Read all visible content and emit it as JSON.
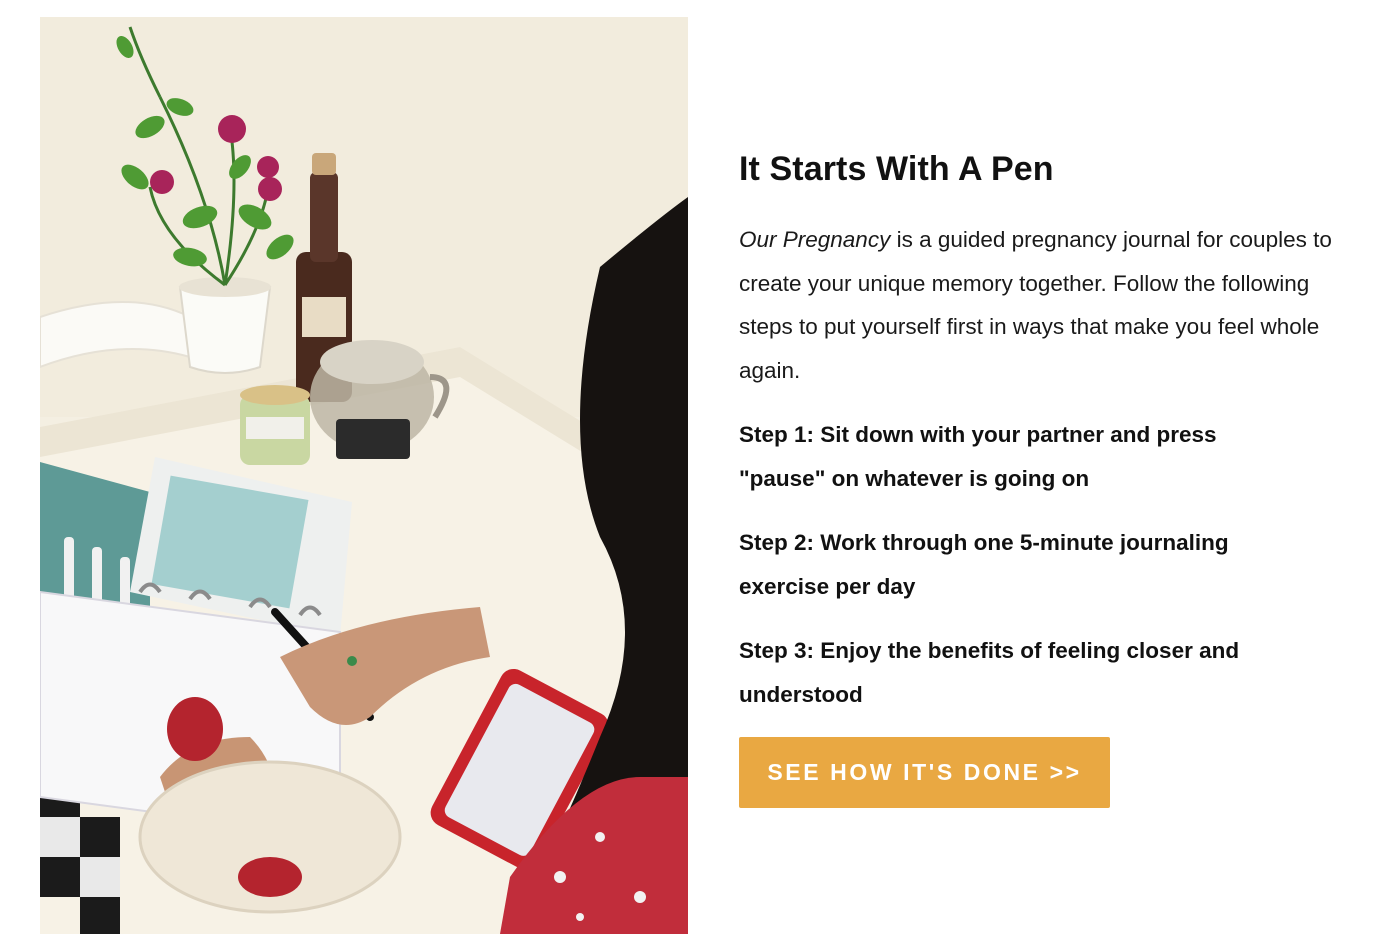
{
  "hero_image": {
    "alt_description": "A pregnancy journal open on a table with a pen, a phone and a bowl of strawberries beside a potted rose plant"
  },
  "section": {
    "title": "It Starts With A Pen",
    "intro_emphasis": "Our Pregnancy",
    "intro_text": " is a guided pregnancy journal for couples to create your unique memory together. Follow the following steps to put yourself first in ways that make you feel whole again.",
    "steps": [
      "Step 1: Sit down with your partner and press \"pause\" on whatever is going on",
      "Step 2: Work through one 5-minute journaling exercise per day",
      "Step 3: Enjoy the benefits of feeling closer and understood"
    ],
    "cta_label": "SEE HOW IT'S DONE >>"
  },
  "colors": {
    "cta_background": "#e9a842",
    "cta_text": "#ffffff",
    "heading": "#111111"
  }
}
